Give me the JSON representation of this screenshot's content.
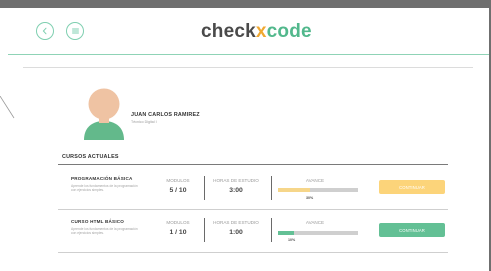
{
  "brand": {
    "logo_pre": "check",
    "logo_x": "x",
    "logo_post": "code",
    "accent_green": "#52b88c",
    "accent_orange": "#f0a830"
  },
  "header": {
    "back_icon": "chevron-left-icon",
    "menu_icon": "hamburger-menu-icon"
  },
  "profile": {
    "name": "JUAN CARLOS RAMIREZ",
    "role": "Técnico Digital I"
  },
  "courses_section": {
    "title": "CURSOS ACTUALES",
    "column_modules": "MODULOS",
    "column_hours": "HORAS DE ESTUDIO",
    "column_progress": "AVANCE",
    "courses": [
      {
        "title": "PROGRAMACIÓN BÁSICA",
        "description": "Aprende los fundamentos de la programación con ejercicios simples.",
        "modules": "5 / 10",
        "hours": "3:00",
        "progress": 0.4,
        "progress_label": "30%",
        "progress_color": "#f6d68a",
        "button_label": "CONTINUAR",
        "button_color": "#fcd47a"
      },
      {
        "title": "CURSO HTML BÁSICO",
        "description": "Aprende los fundamentos de la programación con ejercicios simples.",
        "modules": "1 / 10",
        "hours": "1:00",
        "progress": 0.2,
        "progress_label": "10%",
        "progress_color": "#63c095",
        "button_label": "CONTINUAR",
        "button_color": "#63c095"
      }
    ]
  }
}
